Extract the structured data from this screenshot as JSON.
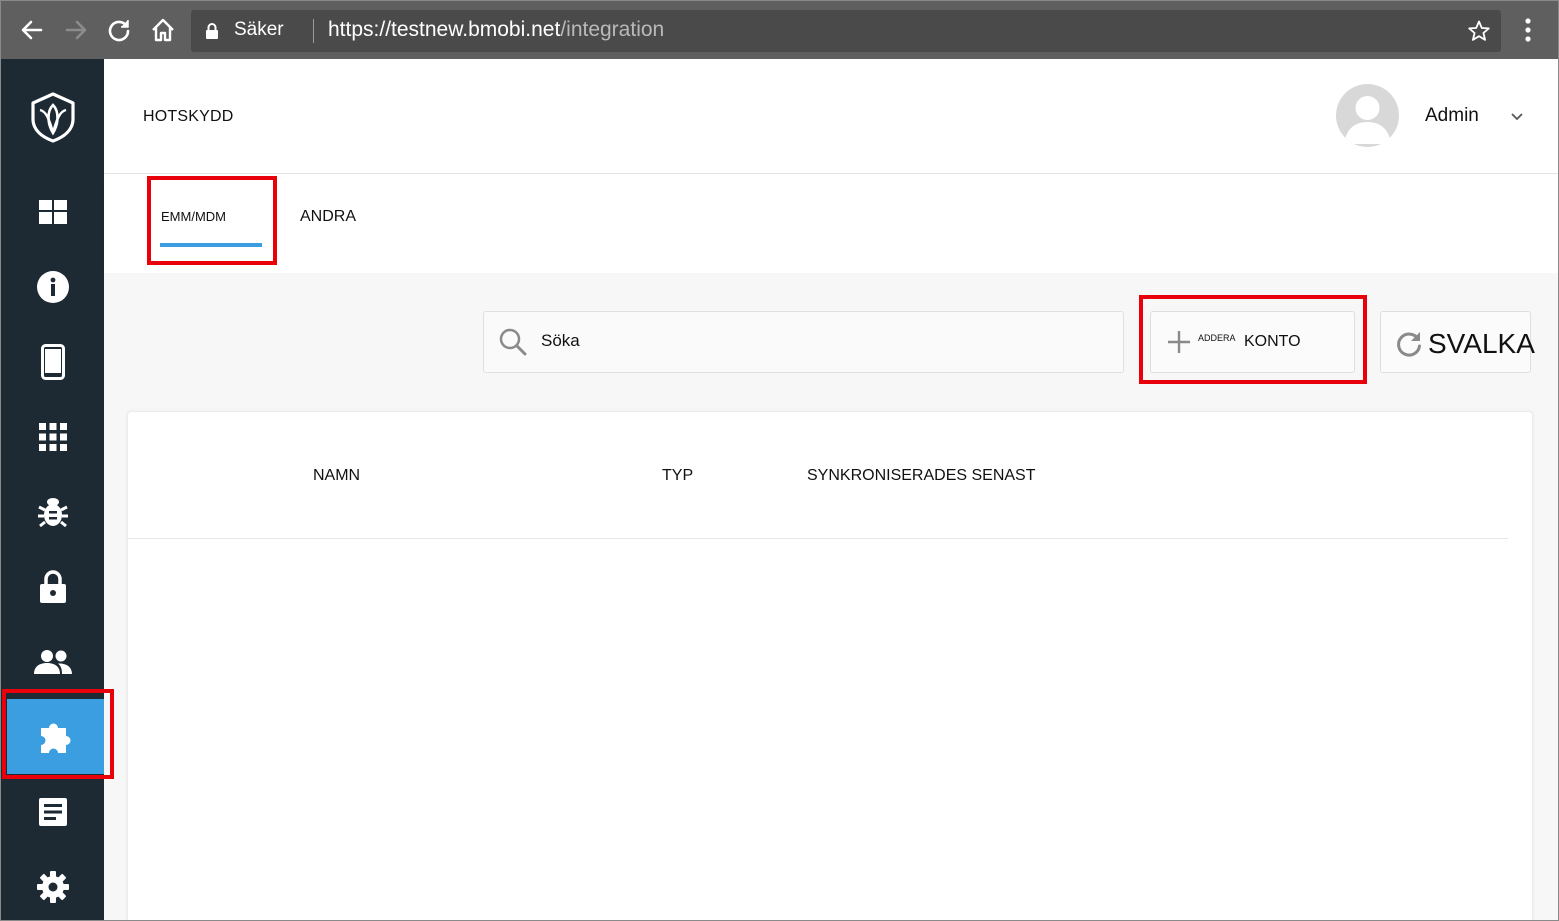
{
  "browser": {
    "secure_label": "Säker",
    "url_host": "https://testnew.bmobi.net",
    "url_path": "/integration"
  },
  "sidebar": {
    "items": [
      {
        "icon": "shield-logo-icon"
      },
      {
        "icon": "dashboard-icon"
      },
      {
        "icon": "info-icon"
      },
      {
        "icon": "device-icon"
      },
      {
        "icon": "apps-grid-icon"
      },
      {
        "icon": "bug-icon"
      },
      {
        "icon": "lock-icon"
      },
      {
        "icon": "users-icon"
      },
      {
        "icon": "puzzle-icon",
        "active": true
      },
      {
        "icon": "report-icon"
      },
      {
        "icon": "settings-icon"
      }
    ]
  },
  "header": {
    "title": "HOTSKYDD",
    "user_name": "Admin"
  },
  "tabs": [
    {
      "label": "EMM/MDM",
      "active": true
    },
    {
      "label": "ANDRA"
    }
  ],
  "toolbar": {
    "search_placeholder": "Söka",
    "add_small": "ADDERA",
    "add_big": "KONTO",
    "refresh_label": "SVALKA"
  },
  "table": {
    "columns": [
      "NAMN",
      "TYP",
      "SYNKRONISERADES SENAST"
    ],
    "rows": []
  },
  "colors": {
    "sidebar_bg": "#1e2a33",
    "accent": "#3b9ee0",
    "highlight": "#e8000b"
  }
}
